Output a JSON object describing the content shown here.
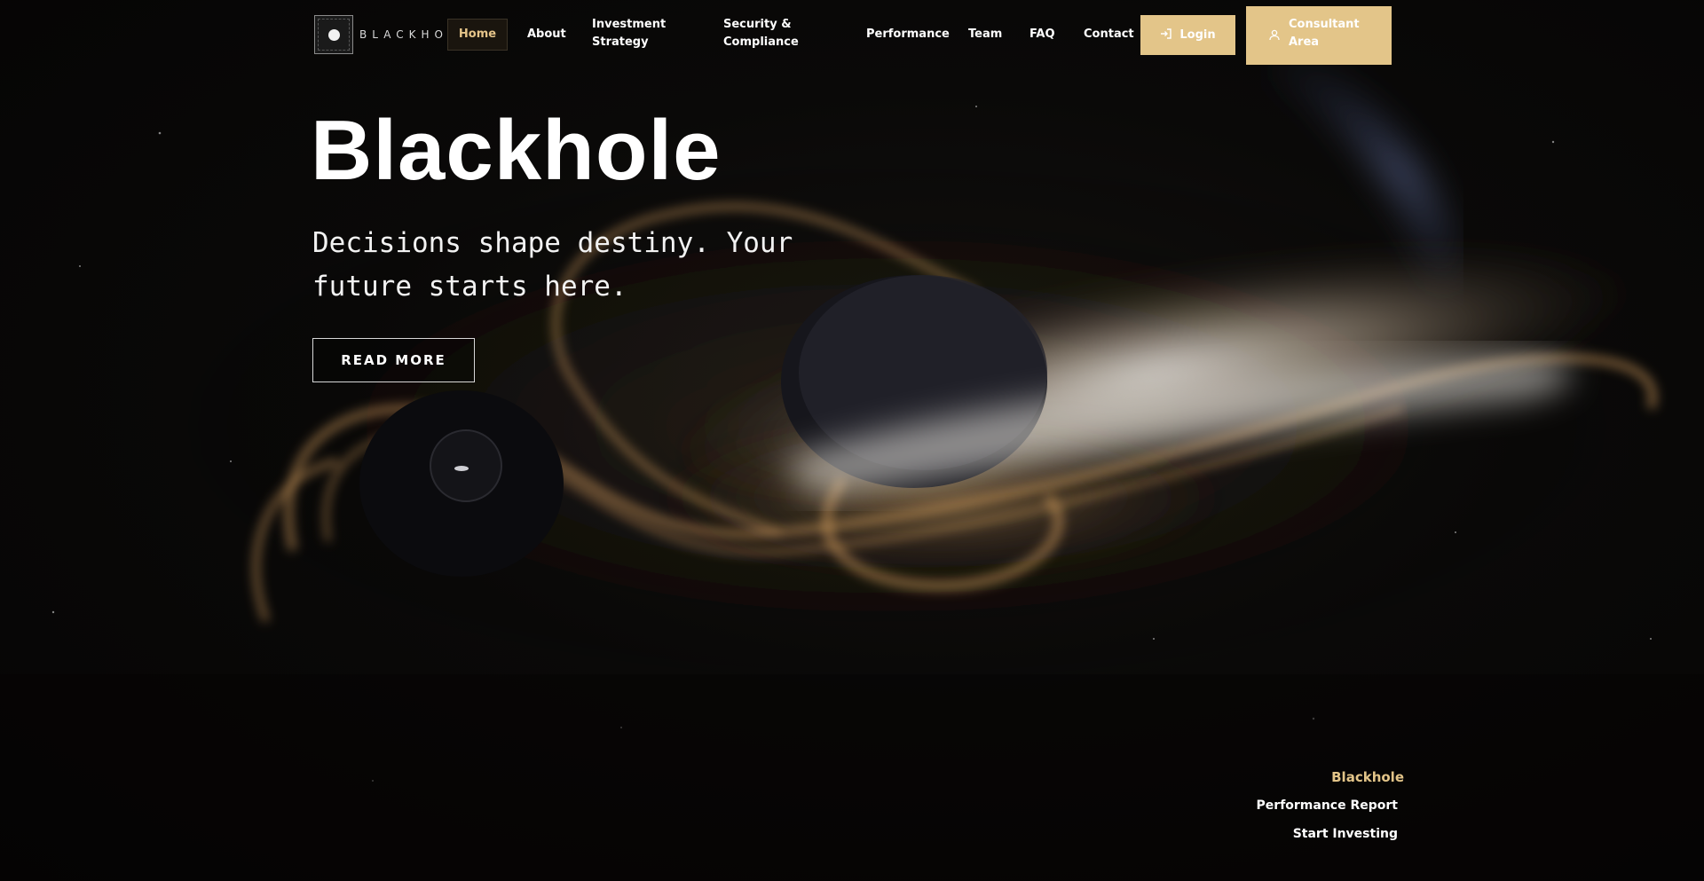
{
  "brand": {
    "logo_text": "BLACKHOLE"
  },
  "nav": {
    "items": [
      {
        "label": "Home",
        "active": true
      },
      {
        "label": "About"
      },
      {
        "label": "Investment Strategy"
      },
      {
        "label": "Security & Compliance"
      },
      {
        "label": "Performance"
      },
      {
        "label": "Team"
      },
      {
        "label": "FAQ"
      },
      {
        "label": "Contact"
      }
    ],
    "login_label": "Login",
    "login_icon": "login-arrow-icon",
    "consultant_label": "Consultant Area",
    "consultant_icon": "user-icon"
  },
  "hero": {
    "title": "Blackhole",
    "subtitle": "Decisions shape destiny. Your future starts here.",
    "cta_label": "READ MORE"
  },
  "side_links": {
    "brand": "Blackhole",
    "items": [
      "Performance Report",
      "Start Investing"
    ]
  },
  "colors": {
    "accent": "#e3c589",
    "background": "#070606",
    "text": "#ffffff"
  }
}
